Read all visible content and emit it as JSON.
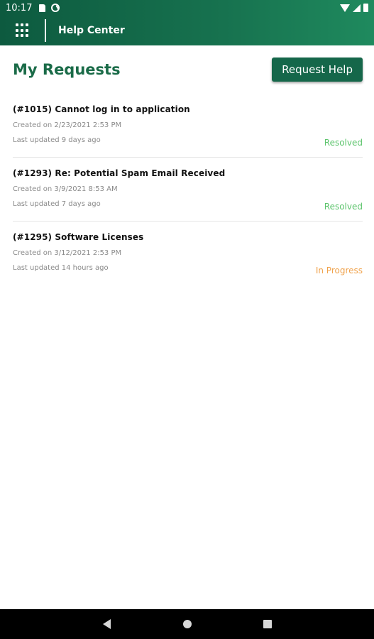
{
  "status_bar": {
    "time": "10:17",
    "icons": [
      "sd-card-icon",
      "sync-icon",
      "wifi-icon",
      "signal-icon",
      "battery-icon"
    ]
  },
  "app_bar": {
    "title": "Help Center",
    "menu_icon": "grid-icon",
    "background_color": "#17724f"
  },
  "main": {
    "title": "My Requests",
    "request_help_label": "Request Help",
    "requests": [
      {
        "title": "(#1015) Cannot log in to application",
        "created": "Created on 2/23/2021 2:53 PM",
        "updated": "Last updated 9 days ago",
        "status": "Resolved",
        "status_color": "#5cc46c"
      },
      {
        "title": "(#1293) Re: Potential Spam Email Received",
        "created": "Created on 3/9/2021 8:53 AM",
        "updated": "Last updated 7 days ago",
        "status": "Resolved",
        "status_color": "#5cc46c"
      },
      {
        "title": "(#1295) Software Licenses",
        "created": "Created on 3/12/2021 2:53 PM",
        "updated": "Last updated 14 hours ago",
        "status": "In Progress",
        "status_color": "#f0a34d"
      }
    ]
  },
  "nav_bar": {
    "icons": [
      "back-icon",
      "home-icon",
      "recent-apps-icon"
    ]
  }
}
